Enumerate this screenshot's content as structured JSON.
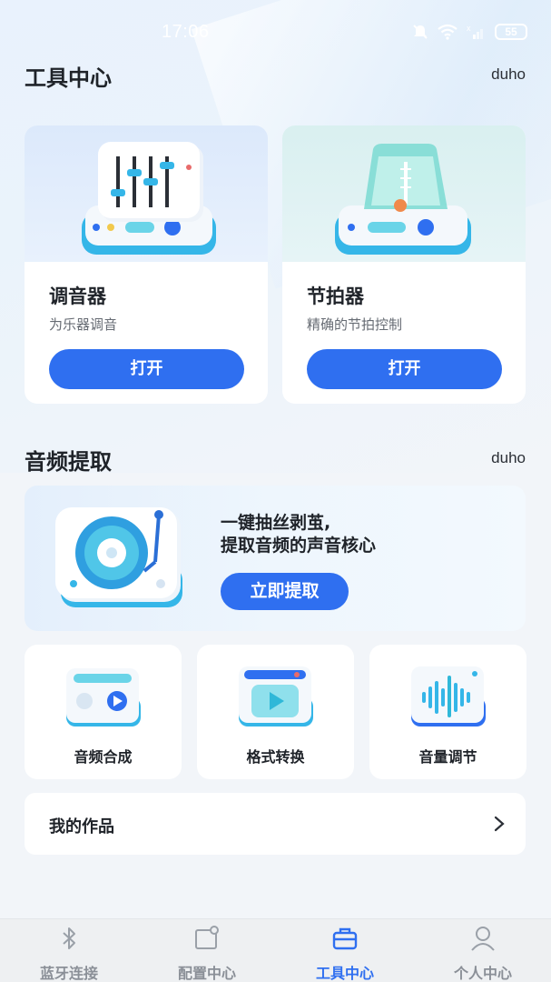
{
  "status_bar": {
    "time": "17:06",
    "battery": "55"
  },
  "tools_section": {
    "title": "工具中心",
    "brand": "duho",
    "cards": [
      {
        "name": "调音器",
        "desc": "为乐器调音",
        "button": "打开",
        "icon": "tuner-mixer-icon"
      },
      {
        "name": "节拍器",
        "desc": "精确的节拍控制",
        "button": "打开",
        "icon": "metronome-icon"
      }
    ]
  },
  "audio_section": {
    "title": "音频提取",
    "brand": "duho",
    "banner": {
      "line1": "一键抽丝剥茧,",
      "line2": "提取音频的声音核心",
      "button": "立即提取",
      "icon": "turntable-icon"
    },
    "features": [
      {
        "label": "音频合成",
        "icon": "audio-synthesis-icon"
      },
      {
        "label": "格式转换",
        "icon": "format-convert-icon"
      },
      {
        "label": "音量调节",
        "icon": "volume-wave-icon"
      }
    ]
  },
  "works": {
    "label": "我的作品"
  },
  "bottom_nav": {
    "items": [
      {
        "label": "蓝牙连接",
        "icon": "bluetooth-icon"
      },
      {
        "label": "配置中心",
        "icon": "config-icon"
      },
      {
        "label": "工具中心",
        "icon": "toolbox-icon"
      },
      {
        "label": "个人中心",
        "icon": "person-icon"
      }
    ],
    "active_index": 2
  },
  "colors": {
    "accent": "#2f6ff0",
    "background": "#f2f5f9",
    "card": "#ffffff"
  }
}
